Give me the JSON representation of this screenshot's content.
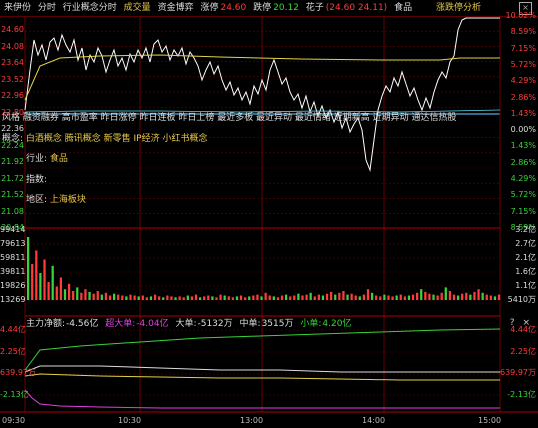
{
  "topbar": {
    "stock_name": "来伊份",
    "mode": "分时",
    "industry_tab": "行业概念分时",
    "vol_label": "成交量",
    "flow_label": "资金博弈",
    "limit_up_label": "涨停",
    "limit_up_value": "24.60",
    "limit_down_label": "跌停",
    "limit_down_value": "20.12",
    "flower_label": "花子",
    "flower_value": "(24.60 24.11)",
    "sector": "食品",
    "analysis_button": "涨跌停分析",
    "close_glyph": "×"
  },
  "price_axis": {
    "left": [
      "24.60",
      "24.08",
      "23.64",
      "23.52",
      "22.96",
      "22.80",
      "22.36",
      "22.24",
      "21.92",
      "21.72",
      "21.52",
      "21.08",
      "20.84"
    ],
    "right": [
      "10.02%",
      "8.59%",
      "7.15%",
      "5.72%",
      "4.29%",
      "2.86%",
      "1.43%",
      "0.00%",
      "1.43%",
      "2.86%",
      "4.29%",
      "5.72%",
      "7.15%",
      "8.59%"
    ]
  },
  "info": {
    "style_label": "风格",
    "style_value": "融资融券 高市盈率 昨日涨停 昨日连板 昨日上榜 最近多板 最近异动 最近情绪 近期新高 近期异动 通达信热股",
    "concept_label": "概念:",
    "concept_value": "白酒概念 腾讯概念 新零售 IP经济 小红书概念",
    "industry_label": "行业:",
    "industry_value": "食品",
    "index_label": "指数:",
    "region_label": "地区:",
    "region_value": "上海板块"
  },
  "volume_axis": {
    "left": [
      "99414",
      "79613",
      "59811",
      "39811",
      "19826",
      "13269"
    ],
    "right": [
      "3.2亿",
      "2.7亿",
      "2.1亿",
      "1.6亿",
      "1.1亿",
      "5410万"
    ]
  },
  "flow": {
    "main_label": "主力净额:",
    "main_value": "-4.56亿",
    "super_label": "超大单:",
    "super_value": "-4.04亿",
    "large_label": "大单:",
    "large_value": "-5132万",
    "medium_label": "中单:",
    "medium_value": "3515万",
    "small_label": "小单:",
    "small_value": "4.20亿",
    "icons": [
      "?",
      "×"
    ],
    "axis_left": [
      "4.44亿",
      "2.25亿",
      "639.97万",
      "-2.13亿"
    ],
    "axis_right": [
      "4.44亿",
      "2.25亿",
      "639.97万",
      "-2.13亿"
    ]
  },
  "time_axis": [
    "09:30",
    "10:30",
    "13:00",
    "14:00",
    "15:00"
  ],
  "colors": {
    "up": "#ff3c3c",
    "down": "#38d43a",
    "price": "#ffffff",
    "avg": "#e6d24a",
    "grid": "#6a0000",
    "mid": "#55aadd"
  }
}
